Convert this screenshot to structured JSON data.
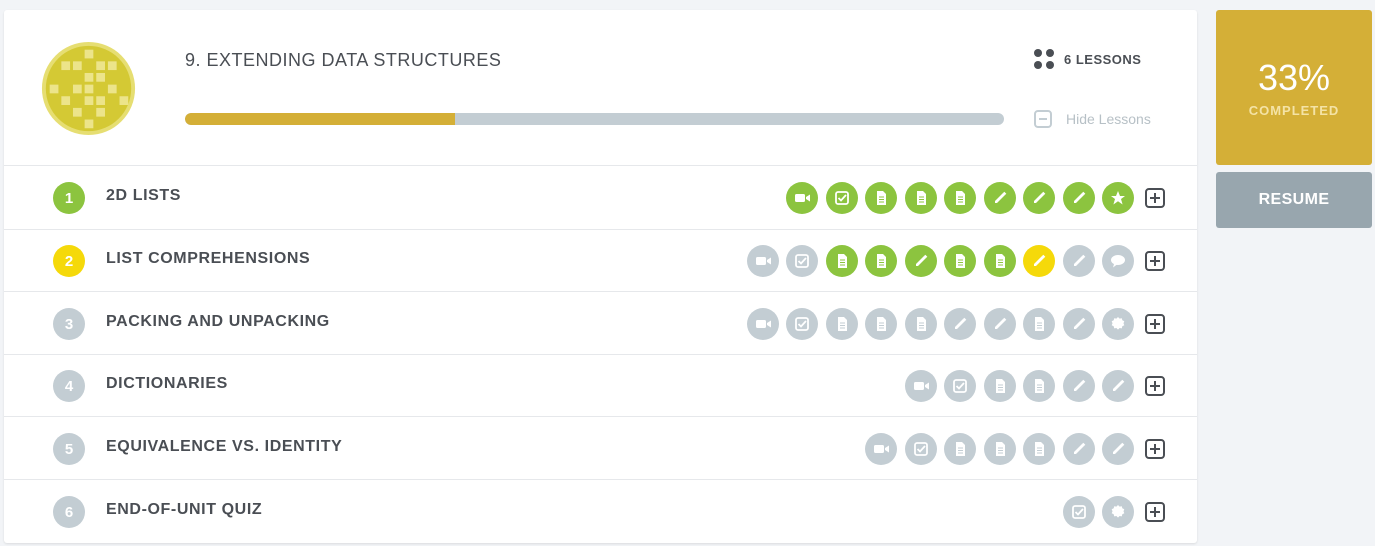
{
  "unit": {
    "title": "9. EXTENDING DATA STRUCTURES",
    "icon": "unit-pixel-badge-icon",
    "progress": 0.33,
    "lessons_count": "6 LESSONS",
    "hide_label": "Hide Lessons"
  },
  "summary": {
    "percent": "33%",
    "completed_label": "COMPLETED",
    "resume_label": "RESUME"
  },
  "colors": {
    "done": "#8cc43f",
    "current": "#f5d90a",
    "todo": "#c3cdd3",
    "accent": "#d4af37",
    "resume": "#98a6ae"
  },
  "lessons": [
    {
      "number": "1",
      "title": "2D LISTS",
      "status": "done",
      "activities": [
        {
          "type": "video",
          "status": "done"
        },
        {
          "type": "check",
          "status": "done"
        },
        {
          "type": "doc",
          "status": "done"
        },
        {
          "type": "doc",
          "status": "done"
        },
        {
          "type": "doc",
          "status": "done"
        },
        {
          "type": "pencil",
          "status": "done"
        },
        {
          "type": "pencil",
          "status": "done"
        },
        {
          "type": "pencil",
          "status": "done"
        },
        {
          "type": "star",
          "status": "done"
        }
      ]
    },
    {
      "number": "2",
      "title": "LIST COMPREHENSIONS",
      "status": "current",
      "activities": [
        {
          "type": "video",
          "status": "todo"
        },
        {
          "type": "check",
          "status": "todo"
        },
        {
          "type": "doc",
          "status": "done"
        },
        {
          "type": "doc",
          "status": "done"
        },
        {
          "type": "pencil",
          "status": "done"
        },
        {
          "type": "doc",
          "status": "done"
        },
        {
          "type": "doc",
          "status": "done"
        },
        {
          "type": "pencil",
          "status": "current"
        },
        {
          "type": "pencil",
          "status": "todo"
        },
        {
          "type": "chat",
          "status": "todo"
        }
      ]
    },
    {
      "number": "3",
      "title": "PACKING AND UNPACKING",
      "status": "todo",
      "activities": [
        {
          "type": "video",
          "status": "todo"
        },
        {
          "type": "check",
          "status": "todo"
        },
        {
          "type": "doc",
          "status": "todo"
        },
        {
          "type": "doc",
          "status": "todo"
        },
        {
          "type": "doc",
          "status": "todo"
        },
        {
          "type": "pencil",
          "status": "todo"
        },
        {
          "type": "pencil",
          "status": "todo"
        },
        {
          "type": "doc",
          "status": "todo"
        },
        {
          "type": "pencil",
          "status": "todo"
        },
        {
          "type": "seal",
          "status": "todo"
        }
      ]
    },
    {
      "number": "4",
      "title": "DICTIONARIES",
      "status": "todo",
      "activities": [
        {
          "type": "video",
          "status": "todo"
        },
        {
          "type": "check",
          "status": "todo"
        },
        {
          "type": "doc",
          "status": "todo"
        },
        {
          "type": "doc",
          "status": "todo"
        },
        {
          "type": "pencil",
          "status": "todo"
        },
        {
          "type": "pencil",
          "status": "todo"
        }
      ]
    },
    {
      "number": "5",
      "title": "EQUIVALENCE VS. IDENTITY",
      "status": "todo",
      "activities": [
        {
          "type": "video",
          "status": "todo"
        },
        {
          "type": "check",
          "status": "todo"
        },
        {
          "type": "doc",
          "status": "todo"
        },
        {
          "type": "doc",
          "status": "todo"
        },
        {
          "type": "doc",
          "status": "todo"
        },
        {
          "type": "pencil",
          "status": "todo"
        },
        {
          "type": "pencil",
          "status": "todo"
        }
      ]
    },
    {
      "number": "6",
      "title": "END-OF-UNIT QUIZ",
      "status": "todo",
      "activities": [
        {
          "type": "check",
          "status": "todo"
        },
        {
          "type": "seal",
          "status": "todo"
        }
      ]
    }
  ]
}
